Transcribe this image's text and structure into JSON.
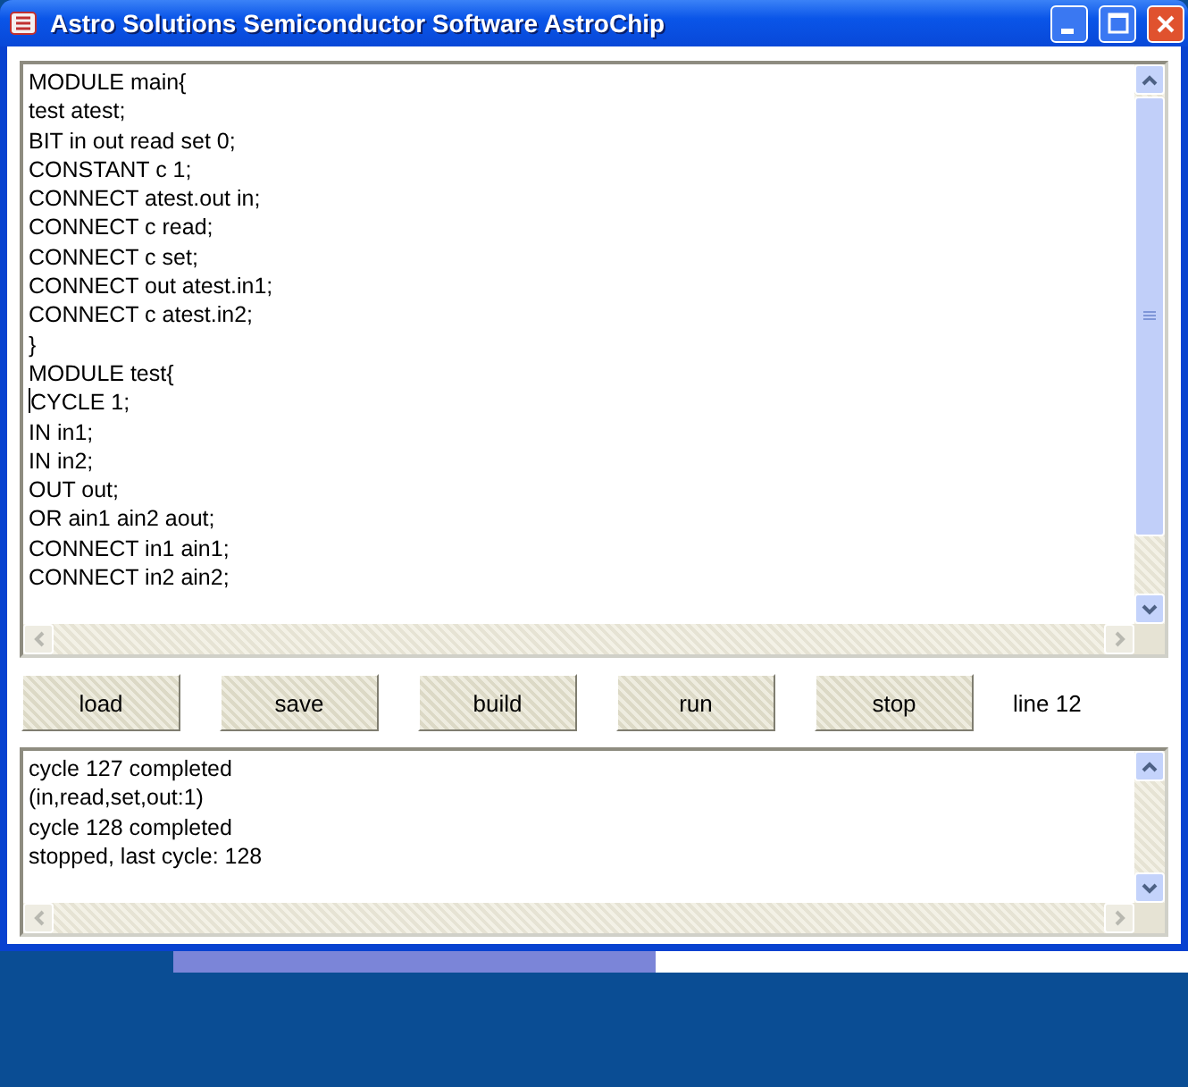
{
  "window": {
    "title": "Astro Solutions Semiconductor Software AstroChip"
  },
  "editor": {
    "lines": [
      {
        "text": "MODULE main{",
        "caret": false
      },
      {
        "text": "test atest;",
        "caret": false
      },
      {
        "text": "BIT in out read set 0;",
        "caret": false
      },
      {
        "text": "CONSTANT c 1;",
        "caret": false
      },
      {
        "text": "CONNECT atest.out in;",
        "caret": false
      },
      {
        "text": "CONNECT c read;",
        "caret": false
      },
      {
        "text": "CONNECT c set;",
        "caret": false
      },
      {
        "text": "CONNECT out atest.in1;",
        "caret": false
      },
      {
        "text": "CONNECT c atest.in2;",
        "caret": false
      },
      {
        "text": "}",
        "caret": false
      },
      {
        "text": "MODULE test{",
        "caret": false
      },
      {
        "text": "CYCLE 1;",
        "caret": true
      },
      {
        "text": "IN in1;",
        "caret": false
      },
      {
        "text": "IN in2;",
        "caret": false
      },
      {
        "text": "OUT out;",
        "caret": false
      },
      {
        "text": "OR ain1 ain2 aout;",
        "caret": false
      },
      {
        "text": "CONNECT in1 ain1;",
        "caret": false
      },
      {
        "text": "CONNECT in2 ain2;",
        "caret": false
      }
    ]
  },
  "buttons": [
    "load",
    "save",
    "build",
    "run",
    "stop"
  ],
  "status": "line 12",
  "output": {
    "lines": [
      "cycle 127 completed",
      "(in,read,set,out:1)",
      "cycle 128 completed",
      "stopped, last cycle: 128"
    ]
  }
}
